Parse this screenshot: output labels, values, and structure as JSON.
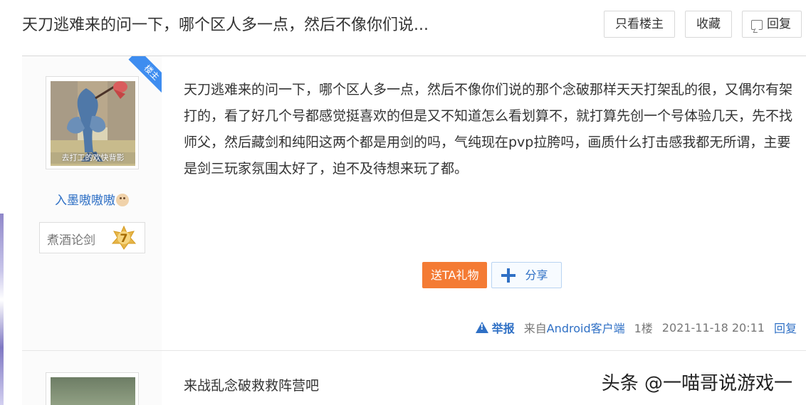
{
  "thread": {
    "title": "天刀逃难来的问一下，哪个区人多一点，然后不像你们说..."
  },
  "header": {
    "buttons": {
      "only_op": "只看楼主",
      "favorite": "收藏",
      "reply": "回复"
    }
  },
  "post": {
    "badge": "楼主",
    "avatar_caption": "去打工的欢快背影",
    "author": "入墨嗷嗷嗷",
    "level_title": "煮酒论剑",
    "level_number": "7",
    "content": "天刀逃难来的问一下，哪个区人多一点，然后不像你们说的那个念破那样天天打架乱的很，又偶尔有架打的，看了好几个号都感觉挺喜欢的但是又不知道怎么看划算不，就打算先创一个号体验几天，先不找师父，然后藏剑和纯阳这两个都是用剑的吗，气纯现在pvp拉胯吗，画质什么打击感我都无所谓，主要是剑三玩家氛围太好了，迫不及待想来玩了都。",
    "actions": {
      "gift": "送TA礼物",
      "share": "分享"
    },
    "meta": {
      "report": "举报",
      "source_prefix": "来自",
      "source": "Android客户端",
      "floor": "1楼",
      "date": "2021-11-18 20:11",
      "reply": "回复"
    }
  },
  "next_post": {
    "content": "来战乱念破救救阵营吧"
  },
  "watermark": "头条 @一喵哥说游戏一",
  "icons": {
    "comment": "comment-icon",
    "share": "plus-icon",
    "report": "warning-icon",
    "level": "star-badge-icon",
    "emoji": "dog-face-emoji-icon"
  },
  "colors": {
    "link": "#2f70c5",
    "gift_button": "#f47b34",
    "op_badge": "#3e8df0",
    "sidebar_bg": "#fbfbfb"
  }
}
